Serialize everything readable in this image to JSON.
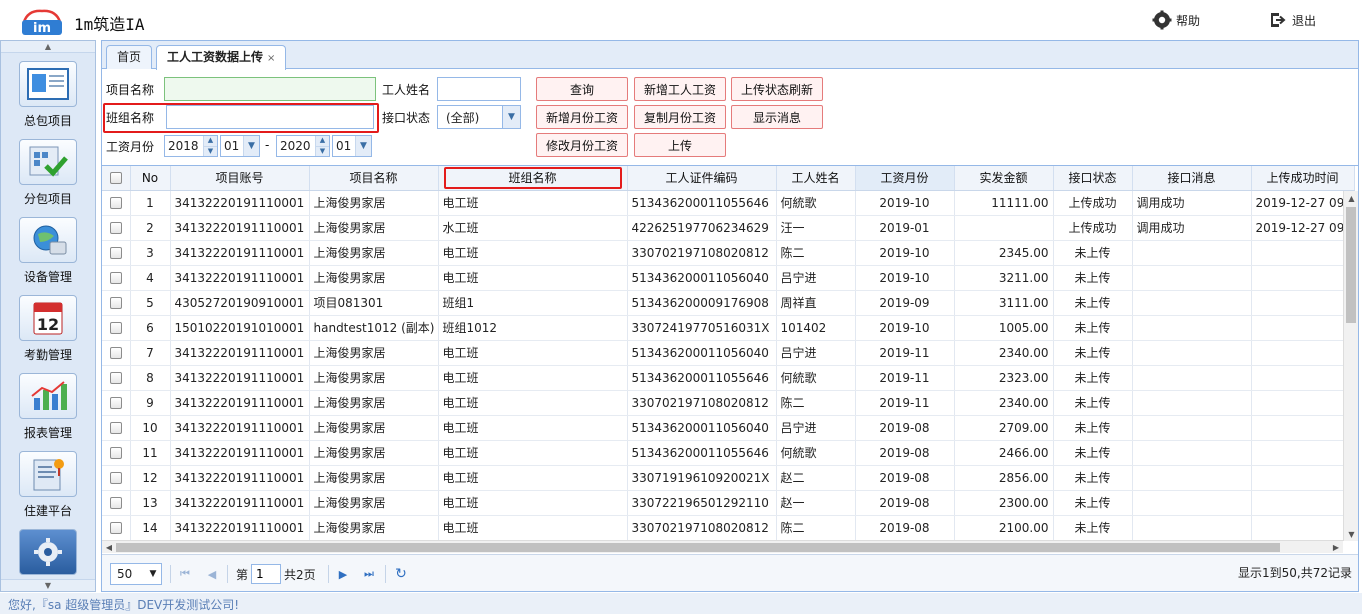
{
  "app": {
    "title": "1m筑造IA",
    "logo_text": "im",
    "help_label": "帮助",
    "logout_label": "退出"
  },
  "sidebar": {
    "items": [
      {
        "label": "总包项目",
        "icon": "project-board-icon"
      },
      {
        "label": "分包项目",
        "icon": "subcontract-check-icon"
      },
      {
        "label": "设备管理",
        "icon": "equipment-globe-icon"
      },
      {
        "label": "考勤管理",
        "icon": "calendar-icon"
      },
      {
        "label": "报表管理",
        "icon": "bar-chart-icon"
      },
      {
        "label": "住建平台",
        "icon": "document-pin-icon"
      },
      {
        "label": "",
        "icon": "settings-gear-icon"
      }
    ]
  },
  "tabs": [
    {
      "label": "首页",
      "active": false
    },
    {
      "label": "工人工资数据上传",
      "active": true,
      "close": "×"
    }
  ],
  "form": {
    "project_name_label": "项目名称",
    "project_name_value": "",
    "worker_name_label": "工人姓名",
    "worker_name_value": "",
    "team_name_label": "班组名称",
    "team_name_value": "",
    "interface_status_label": "接口状态",
    "interface_status_value": "(全部)",
    "salary_month_label": "工资月份",
    "start_year": "2018",
    "start_month": "01",
    "range_sep": "-",
    "end_year": "2020",
    "end_month": "01"
  },
  "buttons": {
    "query": "查询",
    "add_worker_salary": "新增工人工资",
    "refresh_upload_status": "上传状态刷新",
    "add_monthly_salary": "新增月份工资",
    "copy_monthly_salary": "复制月份工资",
    "show_message": "显示消息",
    "edit_monthly_salary": "修改月份工资",
    "upload": "上传"
  },
  "grid": {
    "columns": [
      "No",
      "项目账号",
      "项目名称",
      "班组名称",
      "工人证件编码",
      "工人姓名",
      "工资月份",
      "实发金额",
      "接口状态",
      "接口消息",
      "上传成功时间"
    ],
    "rows": [
      [
        "1",
        "34132220191110001",
        "上海俊男家居",
        "电工班",
        "513436200011055646",
        "何統歌",
        "2019-10",
        "11111.00",
        "上传成功",
        "调用成功",
        "2019-12-27 09"
      ],
      [
        "2",
        "34132220191110001",
        "上海俊男家居",
        "水工班",
        "422625197706234629",
        "汪一",
        "2019-01",
        "",
        "上传成功",
        "调用成功",
        "2019-12-27 09"
      ],
      [
        "3",
        "34132220191110001",
        "上海俊男家居",
        "电工班",
        "330702197108020812",
        "陈二",
        "2019-10",
        "2345.00",
        "未上传",
        "",
        ""
      ],
      [
        "4",
        "34132220191110001",
        "上海俊男家居",
        "电工班",
        "513436200011056040",
        "吕宁进",
        "2019-10",
        "3211.00",
        "未上传",
        "",
        ""
      ],
      [
        "5",
        "43052720190910001",
        "项目081301",
        "班组1",
        "513436200009176908",
        "周祥直",
        "2019-09",
        "3111.00",
        "未上传",
        "",
        ""
      ],
      [
        "6",
        "15010220191010001",
        "handtest1012 (副本)",
        "班组1012",
        "330724197705160​31X",
        "101402",
        "2019-10",
        "1005.00",
        "未上传",
        "",
        ""
      ],
      [
        "7",
        "34132220191110001",
        "上海俊男家居",
        "电工班",
        "513436200011056040",
        "吕宁进",
        "2019-11",
        "2340.00",
        "未上传",
        "",
        ""
      ],
      [
        "8",
        "34132220191110001",
        "上海俊男家居",
        "电工班",
        "513436200011055646",
        "何統歌",
        "2019-11",
        "2323.00",
        "未上传",
        "",
        ""
      ],
      [
        "9",
        "34132220191110001",
        "上海俊男家居",
        "电工班",
        "330702197108020812",
        "陈二",
        "2019-11",
        "2340.00",
        "未上传",
        "",
        ""
      ],
      [
        "10",
        "34132220191110001",
        "上海俊男家居",
        "电工班",
        "513436200011056040",
        "吕宁进",
        "2019-08",
        "2709.00",
        "未上传",
        "",
        ""
      ],
      [
        "11",
        "34132220191110001",
        "上海俊男家居",
        "电工班",
        "513436200011055646",
        "何統歌",
        "2019-08",
        "2466.00",
        "未上传",
        "",
        ""
      ],
      [
        "12",
        "34132220191110001",
        "上海俊男家居",
        "电工班",
        "33071919610920021X",
        "赵二",
        "2019-08",
        "2856.00",
        "未上传",
        "",
        ""
      ],
      [
        "13",
        "34132220191110001",
        "上海俊男家居",
        "电工班",
        "330722196501292110",
        "赵一",
        "2019-08",
        "2300.00",
        "未上传",
        "",
        ""
      ],
      [
        "14",
        "34132220191110001",
        "上海俊男家居",
        "电工班",
        "330702197108020812",
        "陈二",
        "2019-08",
        "2100.00",
        "未上传",
        "",
        ""
      ]
    ]
  },
  "pager": {
    "page_size": "50",
    "page_prefix": "第",
    "page_value": "1",
    "page_suffix": "共2页",
    "summary": "显示1到50,共72记录"
  },
  "status_bar": {
    "text": "您好,『sa 超级管理员』DEV开发测试公司!"
  },
  "colors": {
    "accent_border": "#95b8e7",
    "highlight_red": "#e31b1b",
    "button_border": "#e57b7b"
  }
}
